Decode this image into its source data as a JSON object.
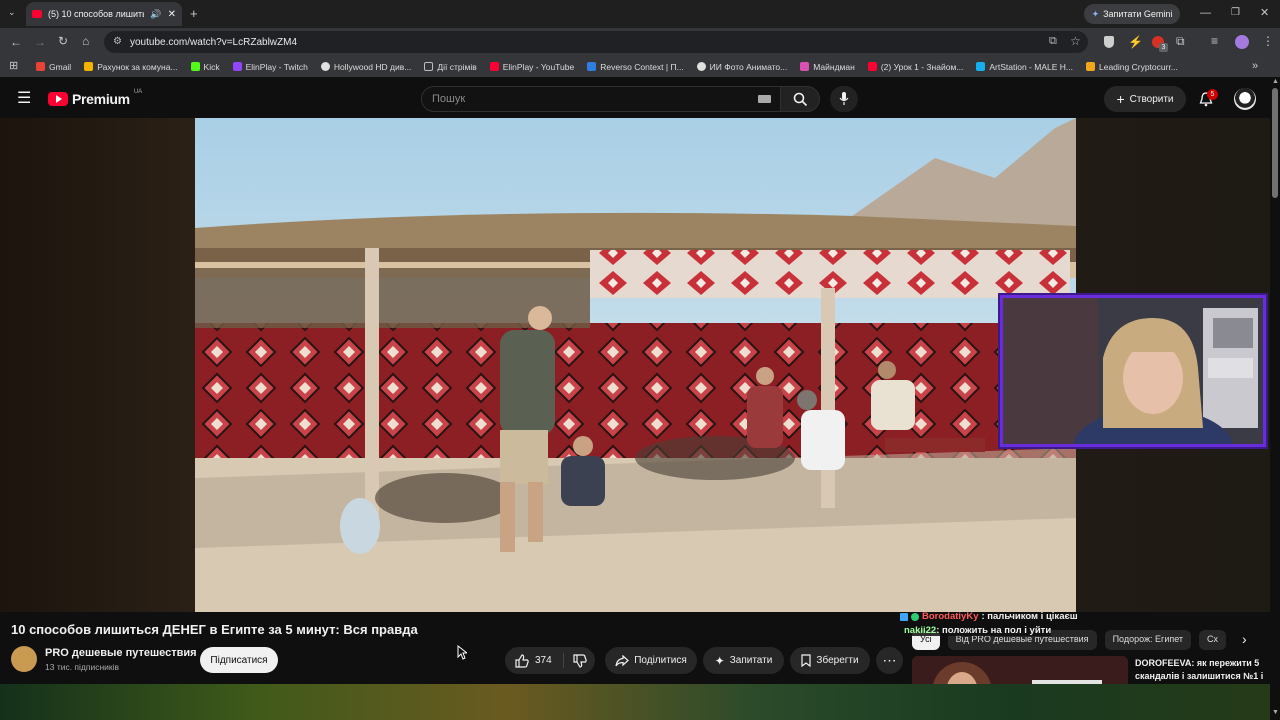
{
  "browser": {
    "tab_title": "(5) 10 способов лишиться",
    "gemini_label": "Запитати Gemini",
    "url": "youtube.com/watch?v=LcRZablwZM4",
    "bookmarks": [
      "Gmail",
      "Рахунок за комуна...",
      "Kick",
      "ElinPlay - Twitch",
      "Hollywood HD див...",
      "Дії стрімів",
      "ElinPlay - YouTube",
      "Reverso Context | П...",
      "ИИ Фото Анимато...",
      "Майндман",
      "(2) Урок 1 - Знайом...",
      "ArtStation - MALE H...",
      "Leading Cryptocurr..."
    ],
    "bookmark_colors": [
      "#ea4335",
      "#f4b400",
      "#53fc18",
      "#9146ff",
      "#e0e0e0",
      "#bdbdbd",
      "#ff0033",
      "#2f7de1",
      "#e0e0e0",
      "#d94fb2",
      "#ff0033",
      "#13aff0",
      "#f0a71c"
    ],
    "extension_badge": "3"
  },
  "youtube": {
    "logo_text": "Premium",
    "region": "UA",
    "search_placeholder": "Пошук",
    "create_label": "Створити",
    "notification_count": "5"
  },
  "video": {
    "title": "10 способов лишиться ДЕНЕГ в Египте за 5 минут: Вся правда",
    "channel_name": "PRO дешевые путешествия",
    "subscribers": "13 тис. підписників",
    "subscribe_label": "Підписатися",
    "likes": "374",
    "share_label": "Поділитися",
    "ask_label": "Запитати",
    "save_label": "Зберегти"
  },
  "chat": [
    {
      "user": "BorodatiyKy",
      "message": ": пальчиком і цікаєш",
      "color": "#ff5a5a"
    },
    {
      "user": "nakii22",
      "message": ": положить на пол і уйти",
      "color": "#9cff9c"
    }
  ],
  "sidebar": {
    "chips": [
      "Усі",
      "Від PRO дешевые путешествия",
      "Подорож: Египет",
      "Сх"
    ],
    "recommended_title": "DOROFEEVA: як пережити 5 скандалів і залишитися №1 і ..."
  }
}
